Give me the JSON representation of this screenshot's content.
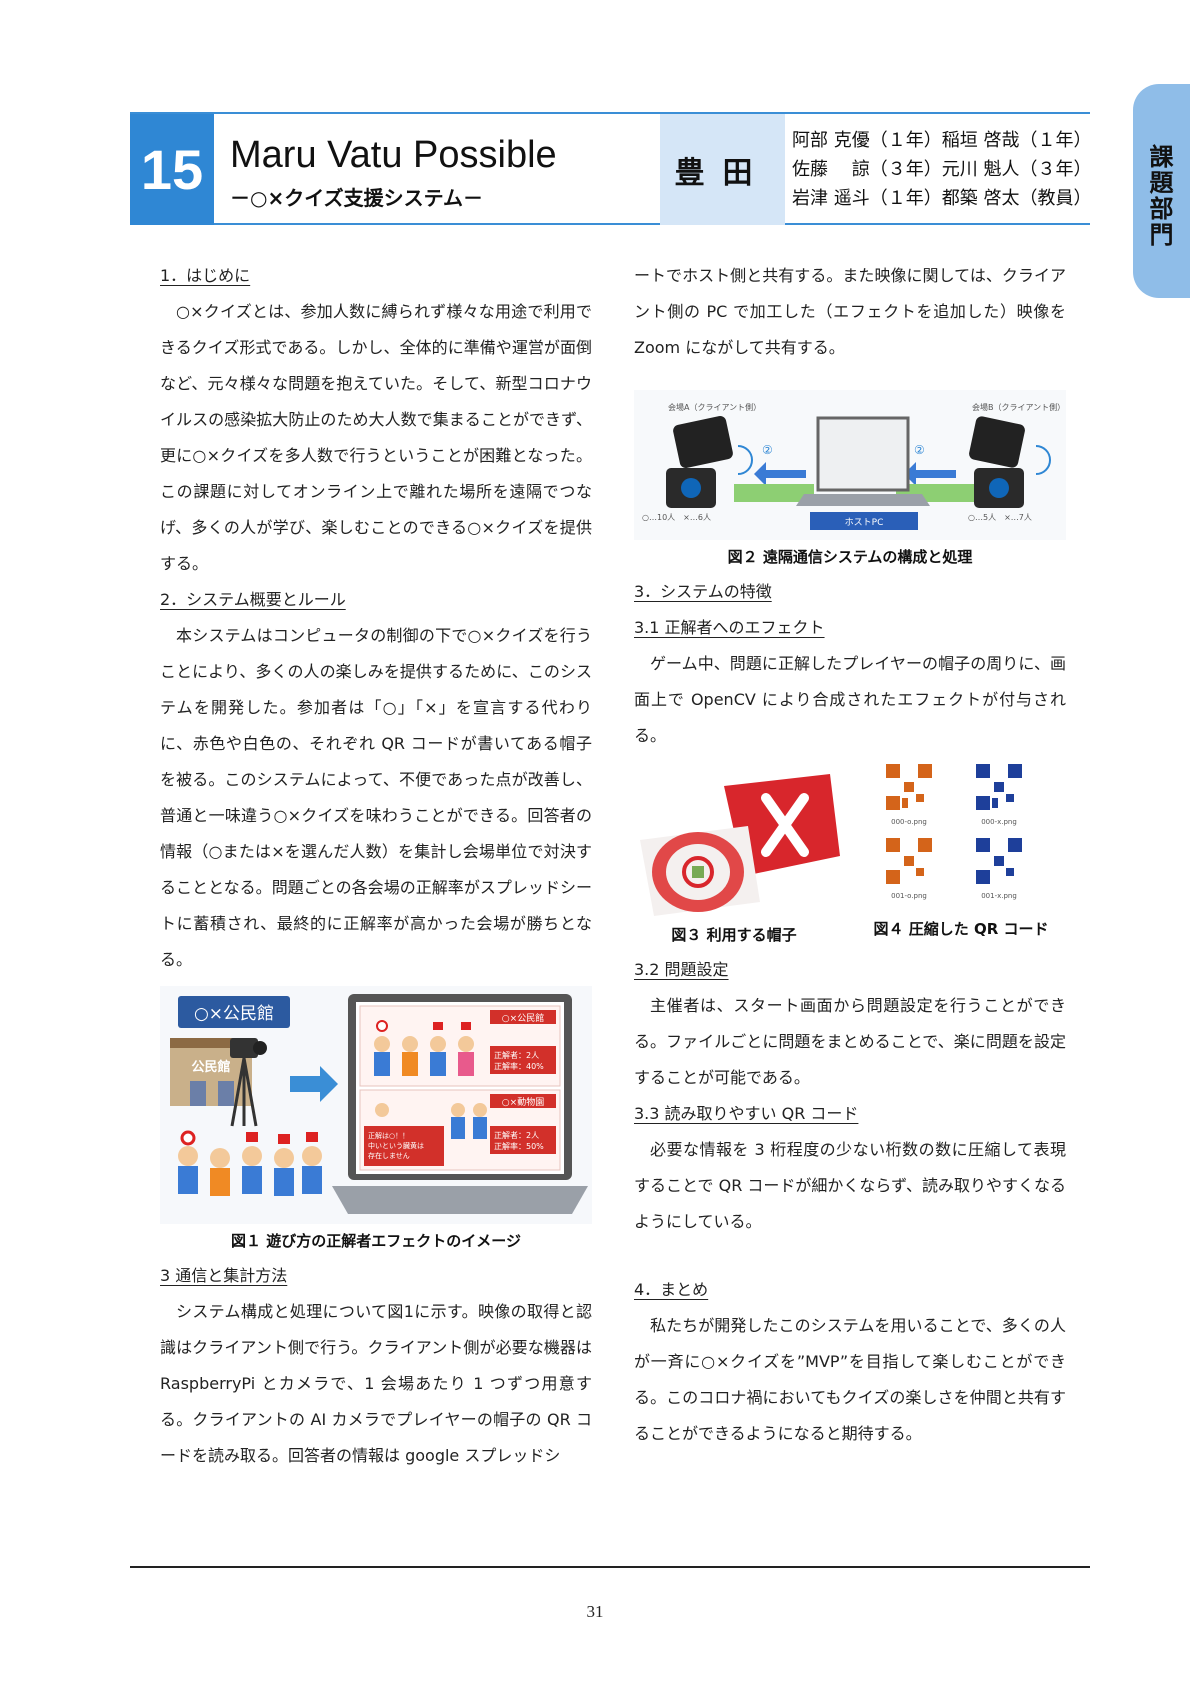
{
  "header": {
    "number": "15",
    "title": "Maru Vatu Possible",
    "subtitle": "－○×クイズ支援システム－",
    "school": "豊田",
    "authors": [
      "阿部 克優（１年）稲垣 啓哉（１年）",
      "佐藤　 諒（３年）元川 魁人（３年）",
      "岩津 遥斗（１年）都築 啓太（教員）"
    ]
  },
  "side_tab": "課題部門",
  "left": {
    "s1_head": "1．はじめに",
    "s1_body": "○×クイズとは、参加人数に縛られず様々な用途で利用できるクイズ形式である。しかし、全体的に準備や運営が面倒など、元々様々な問題を抱えていた。そして、新型コロナウイルスの感染拡大防止のため大人数で集まることができず、更に○×クイズを多人数で行うということが困難となった。この課題に対してオンライン上で離れた場所を遠隔でつなげ、多くの人が学び、楽しむことのできる○×クイズを提供する。",
    "s2_head": "2．システム概要とルール",
    "s2_body": "本システムはコンピュータの制御の下で○×クイズを行うことにより、多くの人の楽しみを提供するために、このシステムを開発した。参加者は「○」「×」を宣言する代わりに、赤色や白色の、それぞれ QR コードが書いてある帽子を被る。このシステムによって、不便であった点が改善し、普通と一味違う○×クイズを味わうことができる。回答者の情報（○または×を選んだ人数）を集計し会場単位で対決することとなる。問題ごとの各会場の正解率がスプレッドシートに蓄積され、最終的に正解率が高かった会場が勝ちとなる。",
    "fig1": {
      "venue": "○×公民館",
      "building": "公民館",
      "panel1_title": "○×公民館",
      "panel1_stats": "正解者：2人\n正解率：40%",
      "panel2_title": "○×動物園",
      "panel2_msg": "正解は○！！\n中いという臓黄は\n存在しません",
      "panel2_stats": "正解者：2人\n正解率：50%",
      "caption": "図１ 遊び方の正解者エフェクトのイメージ"
    },
    "s3_head": "3 通信と集計方法",
    "s3_body": "システム構成と処理について図1に示す。映像の取得と認識はクライアント側で行う。クライアント側が必要な機器は RaspberryPi とカメラで、1 会場あたり 1 つずつ用意する。クライアントの AI カメラでプレイヤーの帽子の QR コードを読み取る。回答者の情報は google スプレッドシ"
  },
  "right": {
    "cont_body": "ートでホスト側と共有する。また映像に関しては、クライアント側の PC で加工した（エフェクトを追加した）映像を Zoom にながして共有する。",
    "fig2": {
      "labelA": "会場A（クライアント側）",
      "labelB": "会場B（クライアント側）",
      "countA": "○…10人　×…6人",
      "countB": "○…5人　×…7人",
      "host": "ホストPC",
      "step": "②",
      "caption": "図２ 遠隔通信システムの構成と処理"
    },
    "s3b_head": "3．システムの特徴",
    "s31_head": "3.1 正解者へのエフェクト",
    "s31_body": "ゲーム中、問題に正解したプレイヤーの帽子の周りに、画面上で OpenCV により合成されたエフェクトが付与される。",
    "fig3_caption": "図３ 利用する帽子",
    "fig4": {
      "labels": [
        "000-o.png",
        "000-x.png",
        "001-o.png",
        "001-x.png"
      ],
      "caption": "図４ 圧縮した QR コード"
    },
    "s32_head": "3.2 問題設定",
    "s32_body": "主催者は、スタート画面から問題設定を行うことができる。ファイルごとに問題をまとめることで、楽に問題を設定することが可能である。",
    "s33_head": "3.3 読み取りやすい QR コード",
    "s33_body": "必要な情報を 3 桁程度の少ない桁数の数に圧縮して表現することで QR コードが細かくならず、読み取りやすくなるようにしている。",
    "s4_head": "4．まとめ",
    "s4_body": "私たちが開発したこのシステムを用いることで、多くの人が一斉に○×クイズを”MVP”を目指して楽しむことができる。このコロナ禍においてもクイズの楽しさを仲間と共有することができるようになると期待する。"
  },
  "page_number": "31",
  "colors": {
    "accent": "#2f87d4",
    "school_bg": "#d5e6f7",
    "tab": "#8fbde8"
  }
}
